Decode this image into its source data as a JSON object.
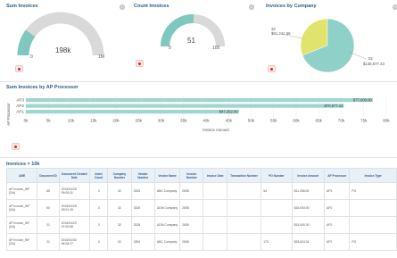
{
  "panels": {
    "sum_invoices": {
      "title": "Sum Invoices",
      "value": "198k",
      "min": "0",
      "max": "1M",
      "fill_fraction": 0.2
    },
    "count_invoices": {
      "title": "Count Invoices",
      "value": "51",
      "min": "0",
      "max": "100",
      "fill_fraction": 0.51
    },
    "invoices_by_company": {
      "title": "Invoices by Company",
      "label_32": "32",
      "label_32_value": "$61,241.56",
      "label_02": "02",
      "label_02_value": "$136,577.43"
    },
    "by_ap_processor": {
      "title": "Sum Invoices by AP Processor"
    }
  },
  "chart_data": [
    {
      "type": "pie",
      "categories": [
        "32",
        "02"
      ],
      "values": [
        61241.56,
        136577.43
      ],
      "colors": [
        "#e0e36c",
        "#8fd0c8"
      ]
    },
    {
      "type": "bar",
      "orientation": "horizontal",
      "categories": [
        "AP3",
        "AP2",
        "AP1"
      ],
      "values": [
        77000,
        70577.43,
        47262.0
      ],
      "value_labels": [
        "$77,000.00",
        "$70,577.43",
        "$47,262.00"
      ],
      "ylabel": "AP Processor",
      "xlabel": "Invoice Amount",
      "xlim": [
        0,
        80000
      ],
      "xticks": [
        "0k",
        "5k",
        "10k",
        "15k",
        "20k",
        "25k",
        "30k",
        "35k",
        "40k",
        "45k",
        "50k",
        "55k",
        "60k",
        "65k",
        "70k",
        "75k",
        "80k"
      ],
      "grid": true,
      "bar_color": "#9fd6d0"
    }
  ],
  "table": {
    "title": "Invoices > 10k",
    "columns": [
      "AME",
      "Document ID",
      "Document Created Date",
      "Index Count",
      "Company Number",
      "Vendor Number",
      "Vendor Name",
      "Invoice Number",
      "Invoice Date",
      "Transaction Number",
      "PO Number",
      "Invoice Amount",
      "AP Processor",
      "Invoice Type"
    ],
    "rows": [
      [
        "AP Invoice_WF (DA)",
        "65",
        "2016/04/28 09:05:31",
        "3",
        "32",
        "3325",
        "ABC Company",
        "2655",
        "",
        "",
        "54",
        "$11,256.00",
        "AP3",
        "PO"
      ],
      [
        "AP Invoice_WF (DA)",
        "50",
        "2016/04/28 09:01:15",
        "3",
        "32",
        "3325",
        "UDM Company",
        "2655",
        "",
        "",
        "",
        "$15,000.00",
        "AP2",
        ""
      ],
      [
        "AP Invoice_WF (DA)",
        "21",
        "2016/04/29 07:09:58",
        "3",
        "32",
        "3325",
        "UDM Company",
        "2655",
        "",
        "",
        "",
        "$15,000.00",
        "AP2",
        ""
      ],
      [
        "AP Invoice_WF (DA)",
        "21",
        "2016/04/30 08:08:27",
        "3",
        "02",
        "3354",
        "ABC Company",
        "2655",
        "",
        "",
        "173",
        "$28,624.04",
        "AP2",
        "PO"
      ]
    ]
  }
}
